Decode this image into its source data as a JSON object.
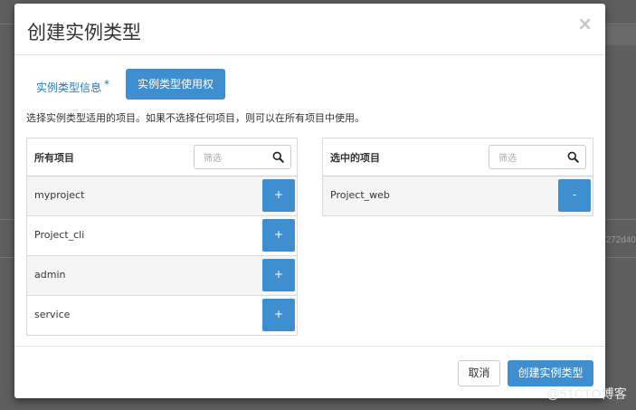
{
  "background": {
    "partial_text": "272d40",
    "watermark": "@51CTO博客"
  },
  "modal": {
    "title": "创建实例类型",
    "close_glyph": "×",
    "tabs": [
      {
        "label": "实例类型信息",
        "required_mark": "*",
        "active": false
      },
      {
        "label": "实例类型使用权",
        "active": true
      }
    ],
    "help_text": "选择实例类型适用的项目。如果不选择任何项目，则可以在所有项目中使用。",
    "all_projects": {
      "title": "所有项目",
      "filter_placeholder": "筛选",
      "items": [
        {
          "name": "myproject",
          "action": "+"
        },
        {
          "name": "Project_cli",
          "action": "+"
        },
        {
          "name": "admin",
          "action": "+"
        },
        {
          "name": "service",
          "action": "+"
        }
      ]
    },
    "selected_projects": {
      "title": "选中的项目",
      "filter_placeholder": "筛选",
      "items": [
        {
          "name": "Project_web",
          "action": "-"
        }
      ]
    },
    "footer": {
      "cancel_label": "取消",
      "submit_label": "创建实例类型"
    }
  },
  "colors": {
    "primary": "#3f8fd0",
    "link": "#2a7ab6",
    "backdrop": "#5e5e5e"
  }
}
